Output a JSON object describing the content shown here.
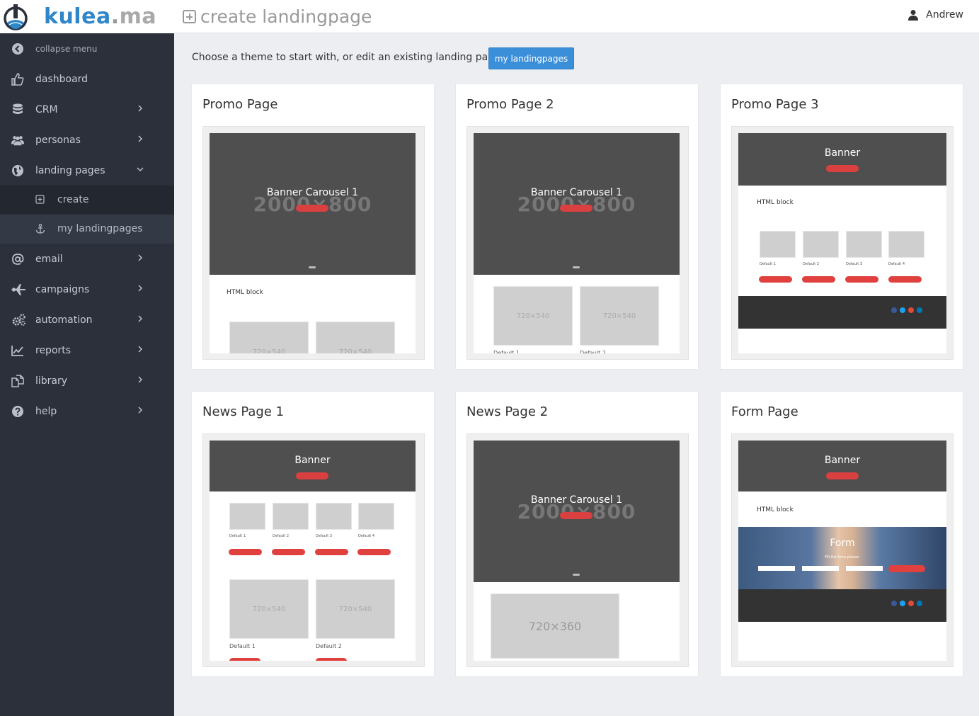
{
  "header": {
    "logo_brand": "kulea",
    "logo_dot": ".",
    "logo_tld": "ma",
    "page_title": "create landingpage",
    "user_name": "Andrew"
  },
  "sidebar": {
    "items": [
      {
        "label": "collapse menu",
        "icon": "chevron-left-circle-icon"
      },
      {
        "label": "dashboard",
        "icon": "thumbs-up-icon"
      },
      {
        "label": "CRM",
        "icon": "database-icon"
      },
      {
        "label": "personas",
        "icon": "users-icon"
      },
      {
        "label": "landing pages",
        "icon": "globe-icon"
      },
      {
        "label": "create",
        "icon": "plus-square-icon"
      },
      {
        "label": "my landingpages",
        "icon": "anchor-icon"
      },
      {
        "label": "email",
        "icon": "at-icon"
      },
      {
        "label": "campaigns",
        "icon": "plane-icon"
      },
      {
        "label": "automation",
        "icon": "cogs-icon"
      },
      {
        "label": "reports",
        "icon": "line-chart-icon"
      },
      {
        "label": "library",
        "icon": "copy-icon"
      },
      {
        "label": "help",
        "icon": "question-circle-icon"
      }
    ]
  },
  "main": {
    "intro": "Choose a theme to start with, or edit an existing landing page in",
    "my_landingpages_button": "my landingpages"
  },
  "themes": [
    {
      "title": "Promo Page"
    },
    {
      "title": "Promo Page 2"
    },
    {
      "title": "Promo Page 3"
    },
    {
      "title": "News Page 1"
    },
    {
      "title": "News Page 2"
    },
    {
      "title": "Form Page"
    }
  ],
  "thumb_text": {
    "banner_carousel": "Banner Carousel 1",
    "big_2000": "2000×800",
    "html_block": "HTML block",
    "banner": "Banner",
    "ph_720x540": "720×540",
    "ph_720x360": "720×360",
    "default_1": "Default 1",
    "default_2": "Default 2",
    "default_3": "Default 3",
    "default_4": "Default 4",
    "form": "Form",
    "fill_form": "Fill the form please."
  },
  "colors": {
    "accent": "#3b8fd9",
    "sidebar_bg": "#2b303b",
    "red": "#d9403f"
  }
}
